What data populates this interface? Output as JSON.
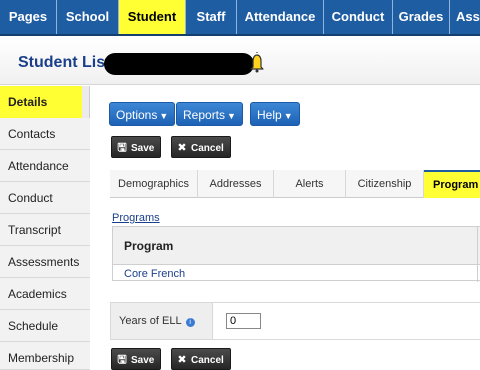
{
  "topnav": {
    "tabs": [
      {
        "label": "Pages",
        "active": false
      },
      {
        "label": "School",
        "active": false
      },
      {
        "label": "Student",
        "active": true
      },
      {
        "label": "Staff",
        "active": false
      },
      {
        "label": "Attendance",
        "active": false
      },
      {
        "label": "Conduct",
        "active": false
      },
      {
        "label": "Grades",
        "active": false
      },
      {
        "label": "Ass",
        "active": false
      }
    ]
  },
  "header": {
    "title": "Student List",
    "bell_icon": "bell-icon"
  },
  "sidenav": {
    "items": [
      {
        "label": "Details",
        "active": true
      },
      {
        "label": "Contacts",
        "active": false
      },
      {
        "label": "Attendance",
        "active": false
      },
      {
        "label": "Conduct",
        "active": false
      },
      {
        "label": "Transcript",
        "active": false
      },
      {
        "label": "Assessments",
        "active": false
      },
      {
        "label": "Academics",
        "active": false
      },
      {
        "label": "Schedule",
        "active": false
      },
      {
        "label": "Membership",
        "active": false
      }
    ]
  },
  "toolbar": {
    "options_label": "Options",
    "reports_label": "Reports",
    "help_label": "Help",
    "save_label": "Save",
    "cancel_label": "Cancel"
  },
  "subtabs": [
    {
      "label": "Demographics",
      "active": false
    },
    {
      "label": "Addresses",
      "active": false
    },
    {
      "label": "Alerts",
      "active": false
    },
    {
      "label": "Citizenship",
      "active": false
    },
    {
      "label": "Program",
      "active": true
    }
  ],
  "programs": {
    "link_label": "Programs",
    "column_header": "Program",
    "rows": [
      "Core French"
    ]
  },
  "ell": {
    "label": "Years of ELL",
    "value": "0"
  },
  "colors": {
    "nav_blue": "#1f5da3",
    "highlight_yellow": "#ffff33",
    "link_blue": "#1a3f8a"
  }
}
